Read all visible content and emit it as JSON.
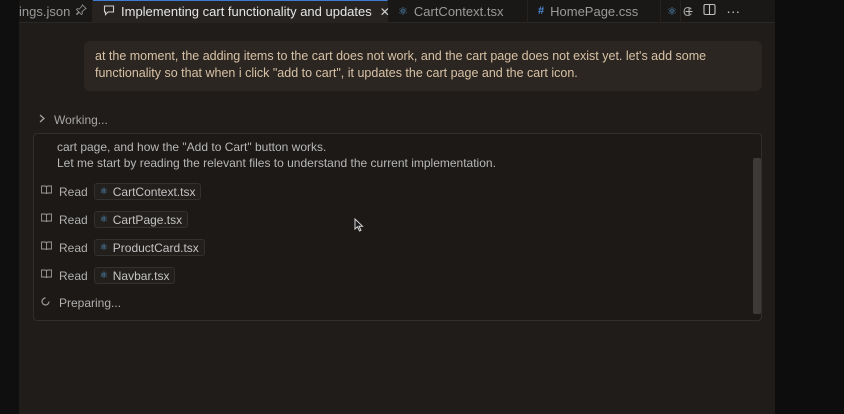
{
  "tabs": {
    "settings": {
      "label": "ings.json",
      "icon": "pin-icon"
    },
    "active": {
      "label": "Implementing cart functionality and updates",
      "icon": "chat-icon",
      "close_glyph": "✕"
    },
    "cart_context": {
      "label": "CartContext.tsx",
      "icon": "react-icon"
    },
    "home_css": {
      "label": "HomePage.css",
      "icon": "hash-icon",
      "glyph": "#"
    },
    "more": {
      "label": "C",
      "icon": "react-icon"
    },
    "actions": {
      "add_glyph": "+",
      "split_glyph": "◫",
      "more_glyph": "···"
    }
  },
  "user_message": {
    "line1": "at the moment, the adding items to the cart does not work, and the cart page does not exist yet. let's add some",
    "line2": "functionality so that when i click \"add to cart\", it updates the cart page and the cart icon."
  },
  "working": {
    "label": "Working..."
  },
  "panel": {
    "clipped_line": "                                                                                                                   ",
    "line_a": "cart page, and how the \"Add to Cart\" button works.",
    "line_b": "Let me start by reading the relevant files to understand the current implementation.",
    "reads": [
      {
        "label": "Read",
        "file": "CartContext.tsx"
      },
      {
        "label": "Read",
        "file": "CartPage.tsx"
      },
      {
        "label": "Read",
        "file": "ProductCard.tsx"
      },
      {
        "label": "Read",
        "file": "Navbar.tsx"
      }
    ],
    "preparing": "Preparing..."
  },
  "colors": {
    "accent": "#3d7bd4",
    "react_icon": "#5aa0d8",
    "user_text": "#d8c2a6",
    "bubble": "#2b2621"
  }
}
